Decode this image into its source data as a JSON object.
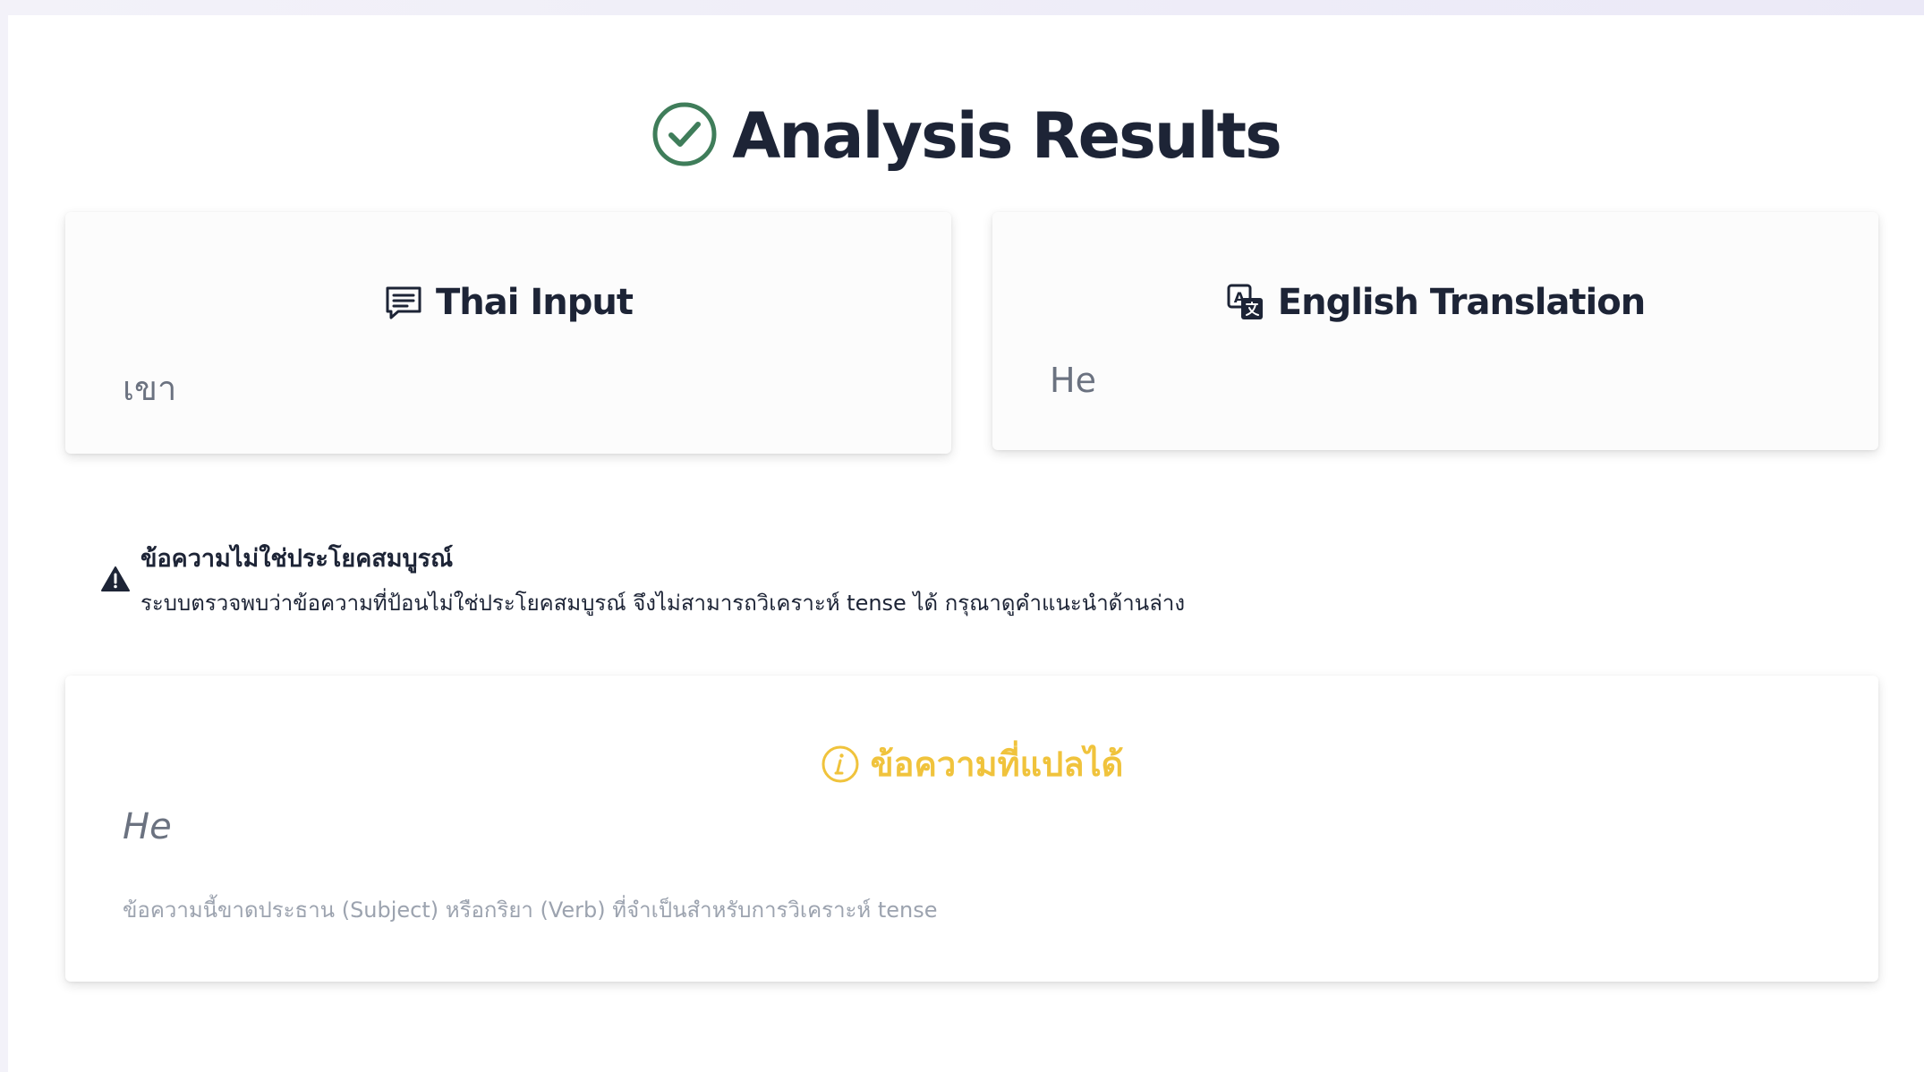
{
  "header": {
    "title": "Analysis Results",
    "icon": "check-circle-icon",
    "icon_color": "#3f7d5a"
  },
  "thai_input": {
    "title": "Thai Input",
    "icon": "chat-lines-icon",
    "text": "เขา"
  },
  "english_translation": {
    "title": "English Translation",
    "icon": "translate-icon",
    "text": "He"
  },
  "warning": {
    "icon": "warning-triangle-icon",
    "title": "ข้อความไม่ใช่ประโยคสมบูรณ์",
    "description": "ระบบตรวจพบว่าข้อความที่ป้อนไม่ใช่ประโยคสมบูรณ์ จึงไม่สามารถวิเคราะห์ tense ได้ กรุณาดูคำแนะนำด้านล่าง"
  },
  "translated_result": {
    "icon": "info-circle-icon",
    "title": "ข้อความที่แปลได้",
    "title_color": "#f0c33c",
    "text": "He",
    "note": "ข้อความนี้ขาดประธาน (Subject) หรือกริยา (Verb) ที่จำเป็นสำหรับการวิเคราะห์ tense"
  }
}
